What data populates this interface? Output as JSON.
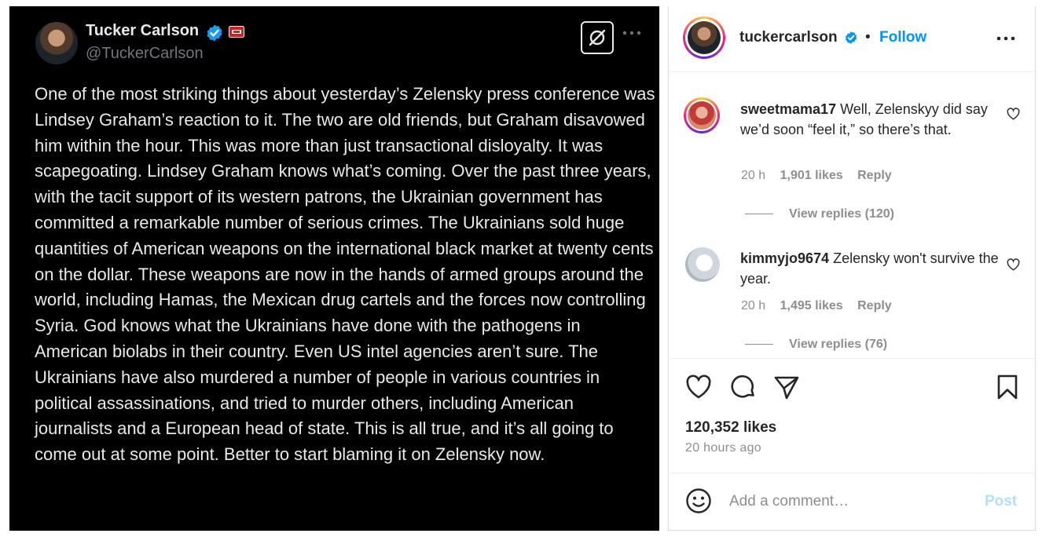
{
  "tweet": {
    "display_name": "Tucker Carlson",
    "handle": "@TuckerCarlson",
    "text": "One of the most striking things about yesterday’s Zelensky press conference was Lindsey Graham’s reaction to it. The two are old friends, but Graham disavowed him within the hour. This was more than just transactional disloyalty. It was scapegoating. Lindsey Graham knows what’s coming. Over the past three years, with the tacit support of its western patrons, the Ukrainian government has committed a remarkable number of serious crimes. The Ukrainians sold huge quantities of American weapons on the international black market at twenty cents on the dollar. These weapons are now in the hands of armed groups around the world, including Hamas, the Mexican drug cartels and the forces now controlling Syria. God knows what the Ukrainians have done with the pathogens in American biolabs in their country. Even US intel agencies aren’t sure. The Ukrainians have also murdered a number of people in various countries in political assassinations, and tried to murder others, including American journalists and a European head of state. This is all true, and it’s all going to come out at some point. Better to start blaming it on Zelensky now.",
    "icons": [
      "verified-badge-icon",
      "affiliate-badge-icon",
      "grok-icon",
      "more-icon"
    ]
  },
  "instagram": {
    "username": "tuckercarlson",
    "separator": "•",
    "follow_label": "Follow",
    "comments": [
      {
        "username": "sweetmama17",
        "text": "Well, Zelenskyy did say we’d soon “feel it,” so there’s that.",
        "time": "20 h",
        "likes": "1,901 likes",
        "reply_label": "Reply",
        "view_replies": "View replies (120)"
      },
      {
        "username": "kimmyjo9674",
        "text": "Zelensky won't survive the year.",
        "time": "20 h",
        "likes": "1,495 likes",
        "reply_label": "Reply",
        "view_replies": "View replies (76)"
      }
    ],
    "likes_count": "120,352 likes",
    "time_ago": "20 hours ago",
    "comment_placeholder": "Add a comment…",
    "post_label": "Post",
    "colors": {
      "accent": "#0095f6",
      "post_disabled": "#b2dffc",
      "verified": "#0095f6"
    }
  }
}
